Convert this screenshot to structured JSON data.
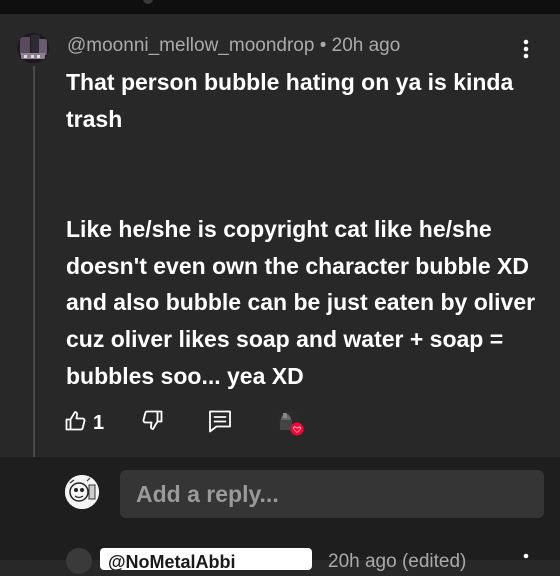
{
  "comment": {
    "author": "@moonni_mellow_moondrop",
    "separator": " • ",
    "time": "20h ago",
    "text": "That person bubble hating on ya is kinda trash\n\n\nLike he/she is copyright cat like he/she doesn't even own the character bubble XD and also bubble can be just eaten by oliver cuz oliver likes soap and water + soap = bubbles soo... yea XD",
    "like_count": "1"
  },
  "reply_box": {
    "placeholder": "Add a reply..."
  },
  "next_reply": {
    "mention": "@NoMetalAbbi",
    "meta": "20h ago (edited)"
  },
  "icons": {
    "like": "thumbs-up-icon",
    "dislike": "thumbs-down-icon",
    "reply": "comment-icon",
    "more": "more-vertical-icon",
    "heart": "creator-heart-icon"
  },
  "colors": {
    "background": "#282828",
    "reply_area": "#1e1e1e",
    "text_primary": "#ffffff",
    "text_secondary": "#aaaaaa",
    "heart": "#ff0033"
  }
}
